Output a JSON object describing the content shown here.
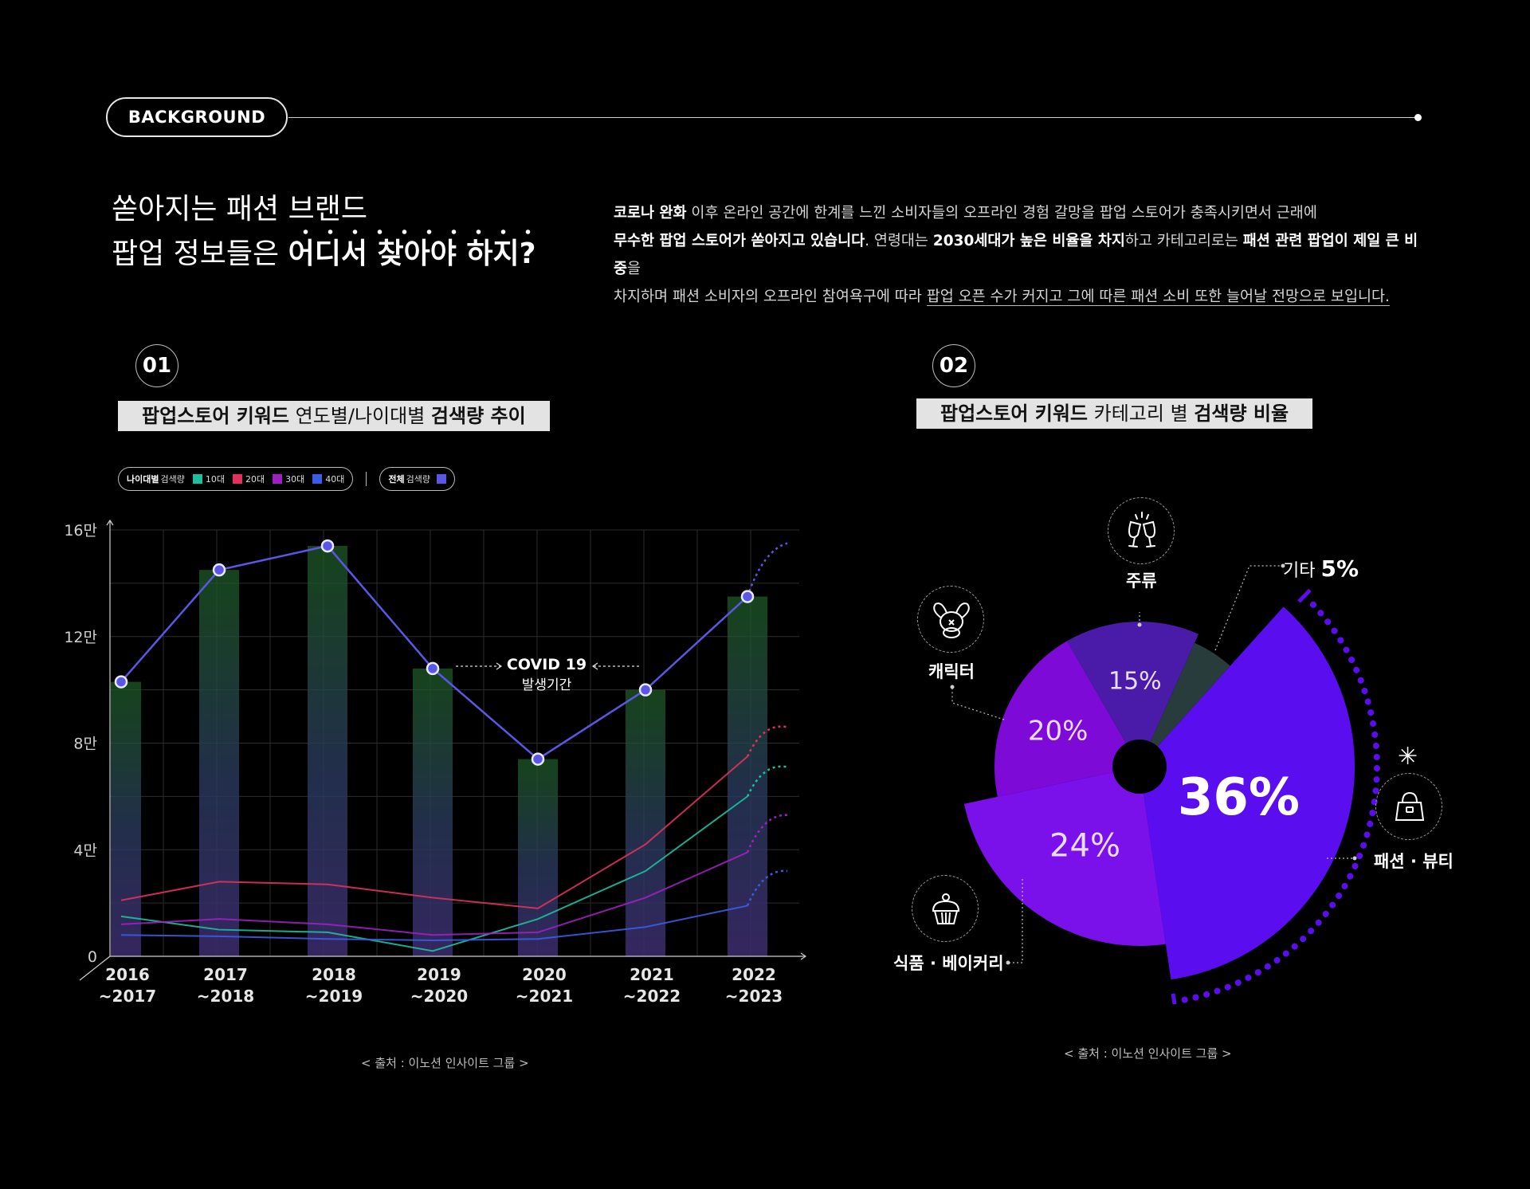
{
  "header": {
    "tag": "BACKGROUND",
    "headline_line1": "쏟아지는 패션 브랜드",
    "headline_line2_prefix": "팝업 정보들은 ",
    "headline_line2_bold": "어디서 찾아야 하지?",
    "desc": {
      "p1_bold": "코로나 완화",
      "p1_text": " 이후 온라인 공간에 한계를 느낀 소비자들의 오프라인 경험 갈망을 팝업 스토어가 충족시키면서 근래에",
      "p2_bold": "무수한 팝업 스토어가 쏟아지고 있습니다",
      "p2_text": ". 연령대는 ",
      "p2_bold2": "2030세대가 높은 비율을 차지",
      "p2_text2": "하고 카테고리로는 ",
      "p2_bold3": "패션 관련 팝업이 제일 큰 비중",
      "p2_text3": "을",
      "p3_text": "차지하며 패션 소비자의 오프라인 참여욕구에 따라 ",
      "p3_ul": "팝업 오픈 수가 커지고 그에 따른 패션 소비 또한 늘어날 전망으로 보입니다."
    }
  },
  "section1": {
    "number": "01",
    "title_bold1": "팝업스토어 키워드",
    "title_text": " 연도별/나이대별 ",
    "title_bold2": "검색량 추이",
    "legend": {
      "age_bold": "나이대별",
      "age_text": " 검색량",
      "items": [
        "10대",
        "20대",
        "30대",
        "40대"
      ],
      "total_bold": "전체",
      "total_text": " 검색량"
    },
    "annotation_line1": "COVID 19",
    "annotation_line2": "발생기간",
    "source": "< 출처 : 이노션 인사이트 그룹 >"
  },
  "section2": {
    "number": "02",
    "title_bold1": "팝업스토어 키워드",
    "title_text": " 카테고리 별 ",
    "title_bold2": "검색량 비율",
    "source": "< 출처 : 이노션 인사이트 그룹 >",
    "icons": [
      "wine-glasses-icon",
      "bunny-icon",
      "handbag-icon",
      "cupcake-icon",
      "sparkle-icon"
    ]
  },
  "colors": {
    "total": "#5b57e6",
    "teen": "#1dbf9e",
    "twenties": "#e0315f",
    "thirties": "#a01fc2",
    "forties": "#3b5ce6",
    "pie_fashion": "#5a0ef0",
    "pie_food": "#7a10ea",
    "pie_character": "#7e0ad8",
    "pie_liquor": "#4a1aa8",
    "pie_other": "#283c3c"
  },
  "chart_data": [
    {
      "type": "line",
      "categories": [
        "2016\n~2017",
        "2017\n~2018",
        "2018\n~2019",
        "2019\n~2020",
        "2020\n~2021",
        "2021\n~2022",
        "2022\n~2023"
      ],
      "yticks": [
        "0",
        "4만",
        "8만",
        "12만",
        "16만"
      ],
      "ylim": [
        0,
        160000
      ],
      "grid": true,
      "series": [
        {
          "name": "전체",
          "values": [
            103000,
            145000,
            154000,
            108000,
            74000,
            100000,
            135000
          ],
          "projection": 155000,
          "style": "line+bars"
        },
        {
          "name": "10대",
          "values": [
            15000,
            10000,
            9000,
            2000,
            14000,
            32000,
            60000
          ],
          "projection": 71000
        },
        {
          "name": "20대",
          "values": [
            21000,
            28000,
            27000,
            22000,
            18000,
            42000,
            75000
          ],
          "projection": 86000
        },
        {
          "name": "30대",
          "values": [
            12000,
            14000,
            12000,
            8000,
            9000,
            22000,
            39000
          ],
          "projection": 53000
        },
        {
          "name": "40대",
          "values": [
            8000,
            7500,
            6500,
            6000,
            6500,
            11000,
            19000
          ],
          "projection": 32000
        }
      ]
    },
    {
      "type": "pie",
      "slices": [
        {
          "label": "패션 · 뷰티",
          "value": 36,
          "display": "36%"
        },
        {
          "label": "식품 · 베이커리",
          "value": 24,
          "display": "24%"
        },
        {
          "label": "캐릭터",
          "value": 20,
          "display": "20%"
        },
        {
          "label": "주류",
          "value": 15,
          "display": "15%"
        },
        {
          "label": "기타",
          "value": 5,
          "display": "5%"
        }
      ]
    }
  ]
}
